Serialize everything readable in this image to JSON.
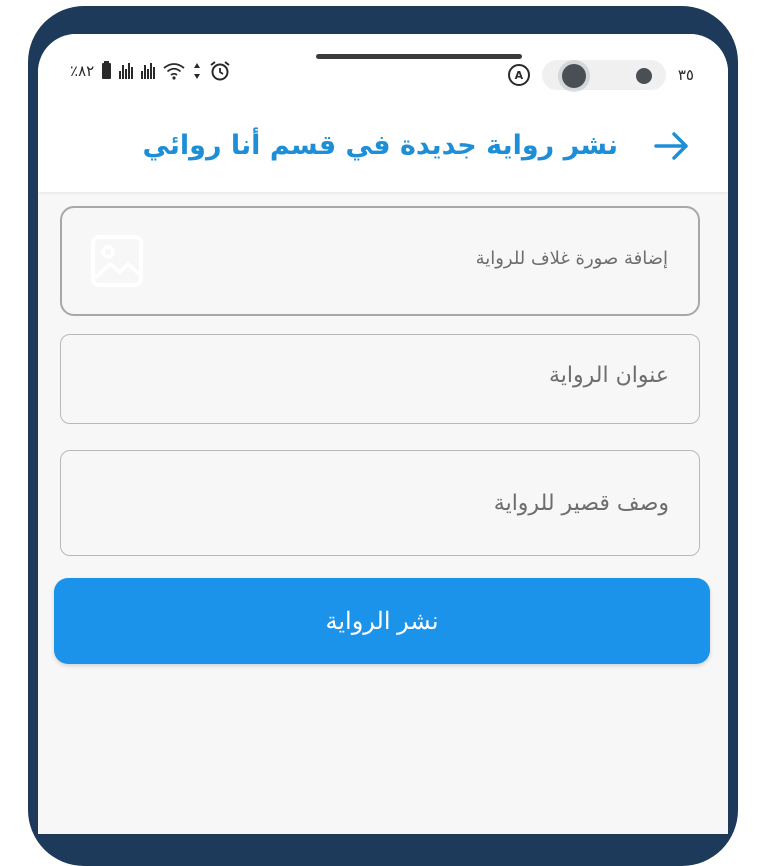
{
  "status_bar": {
    "battery_text": "٪٨٢",
    "time_text": "٣٥"
  },
  "header": {
    "title": "نشر رواية جديدة في قسم أنا روائي",
    "back_icon": "arrow-right-icon"
  },
  "form": {
    "cover_label": "إضافة صورة غلاف للرواية",
    "cover_icon": "image-icon",
    "title_placeholder": "عنوان الرواية",
    "description_placeholder": "وصف قصير للرواية"
  },
  "actions": {
    "publish_label": "نشر الرواية"
  },
  "colors": {
    "accent": "#1e8fd6",
    "button": "#1b93ea",
    "frame": "#1e3a5b"
  }
}
